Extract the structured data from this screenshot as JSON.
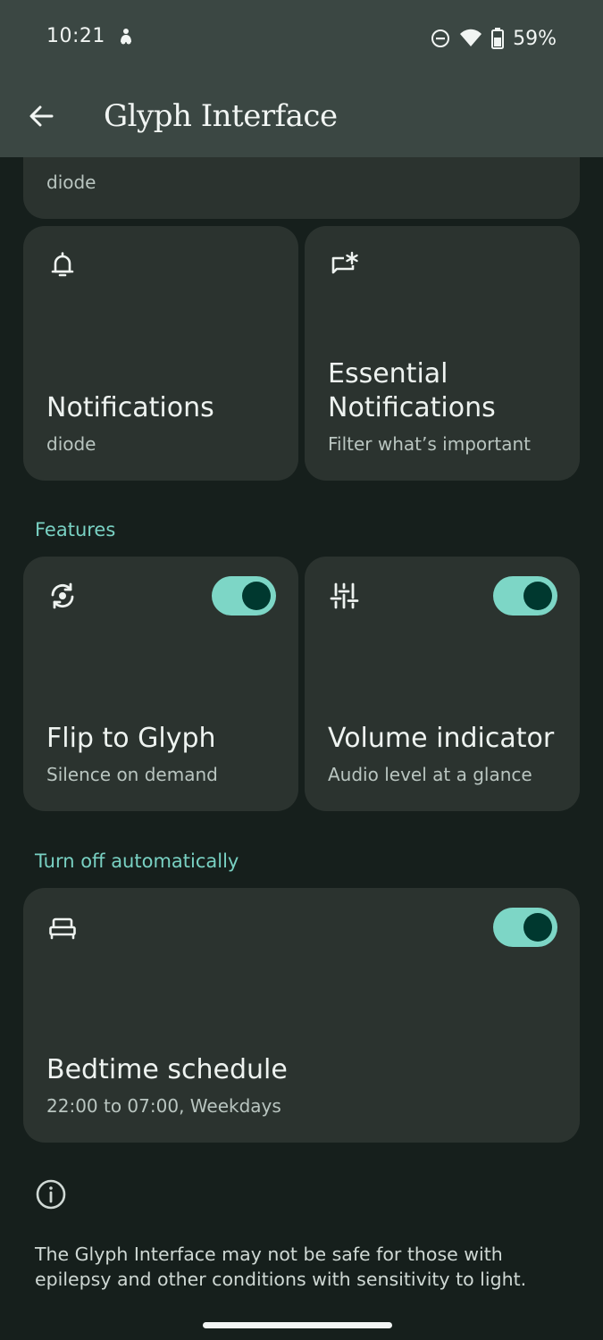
{
  "status_bar": {
    "time": "10:21",
    "app_icon": "assistant-icon",
    "dnd_icon": "do-not-disturb-icon",
    "wifi_icon": "wifi-icon",
    "battery_icon": "battery-icon",
    "battery_text": "59%"
  },
  "app_bar": {
    "back_icon": "arrow-back-icon",
    "title": "Glyph Interface"
  },
  "cards": {
    "ringtone_partial": {
      "subtitle": "diode"
    },
    "notifications": {
      "icon": "bell-icon",
      "title": "Notifications",
      "subtitle": "diode"
    },
    "essential": {
      "icon": "essential-notification-icon",
      "title_line1": "Essential",
      "title_line2": "Notifications",
      "subtitle": "Filter what’s important"
    }
  },
  "features": {
    "label": "Features",
    "flip": {
      "icon": "flip-rotate-icon",
      "title": "Flip to Glyph",
      "subtitle": "Silence on demand",
      "enabled": true
    },
    "volume": {
      "icon": "volume-sliders-icon",
      "title": "Volume indicator",
      "subtitle": "Audio level at a glance",
      "enabled": true
    }
  },
  "auto_off": {
    "label": "Turn off automatically",
    "bedtime": {
      "icon": "bed-icon",
      "title": "Bedtime schedule",
      "subtitle": "22:00 to 07:00, Weekdays",
      "enabled": true
    }
  },
  "footer": {
    "info_icon": "info-icon",
    "warning": "The Glyph Interface may not be safe for those with epilepsy and other conditions with sensitivity to light."
  },
  "colors": {
    "background": "#161f1c",
    "app_bar": "#3b4743",
    "card": "#2b332f",
    "accent": "#79d1c3",
    "toggle_track": "#7dd6c6",
    "toggle_knob": "#00382f"
  }
}
